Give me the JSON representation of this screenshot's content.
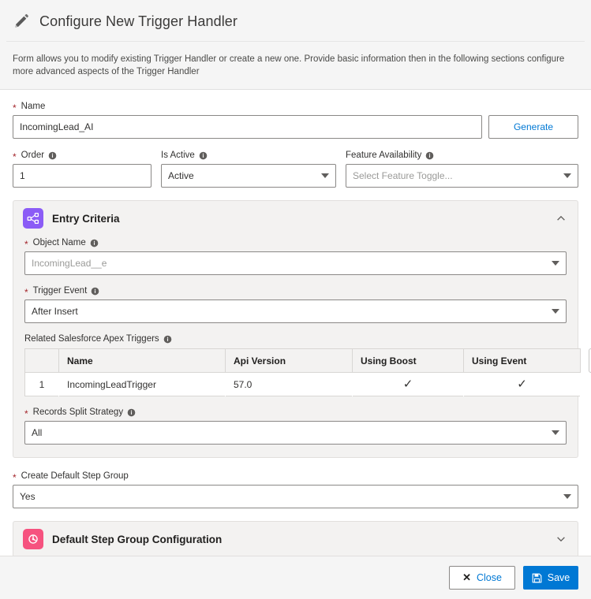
{
  "header": {
    "icon": "pencil-icon",
    "title": "Configure New Trigger Handler",
    "description": "Form allows you to modify existing Trigger Handler or create a new one. Provide basic information then in the following sections configure more advanced aspects of the Trigger Handler"
  },
  "form": {
    "name": {
      "label": "Name",
      "required": true,
      "value": "IncomingLead_AI",
      "placeholder": ""
    },
    "generate_button": "Generate",
    "order": {
      "label": "Order",
      "required": true,
      "value": "1",
      "info": "info-icon"
    },
    "is_active": {
      "label": "Is Active",
      "required": false,
      "value": "Active",
      "info": "info-icon"
    },
    "feature_availability": {
      "label": "Feature Availability",
      "required": false,
      "value": "",
      "placeholder": "Select Feature Toggle...",
      "info": "info-icon"
    },
    "create_default_step_group": {
      "label": "Create Default Step Group",
      "required": true,
      "value": "Yes"
    }
  },
  "entry_criteria": {
    "title": "Entry Criteria",
    "icon": "nodes-icon",
    "icon_color": "#8b5cf6",
    "expanded": true,
    "chevron": "chevron-up-icon",
    "object_name": {
      "label": "Object Name",
      "required": true,
      "value": "IncomingLead__e",
      "info": "info-icon"
    },
    "trigger_event": {
      "label": "Trigger Event",
      "required": true,
      "value": "After Insert",
      "info": "info-icon"
    },
    "related_triggers": {
      "label": "Related Salesforce Apex Triggers",
      "info": "info-icon",
      "refresh_icon": "refresh-icon",
      "columns": [
        "",
        "Name",
        "Api Version",
        "Using Boost",
        "Using Event"
      ],
      "rows": [
        {
          "index": "1",
          "name": "IncomingLeadTrigger",
          "api_version": "57.0",
          "using_boost": "✓",
          "using_event": "✓"
        }
      ]
    },
    "records_split_strategy": {
      "label": "Records Split Strategy",
      "required": true,
      "value": "All",
      "info": "info-icon"
    }
  },
  "default_step_group": {
    "title": "Default Step Group Configuration",
    "icon": "step-group-icon",
    "icon_color": "#f6527f",
    "expanded": false,
    "chevron": "chevron-down-icon"
  },
  "footer": {
    "close_label": "Close",
    "close_icon": "close-x-icon",
    "save_label": "Save",
    "save_icon": "save-disk-icon",
    "save_color": "#0078d4"
  }
}
